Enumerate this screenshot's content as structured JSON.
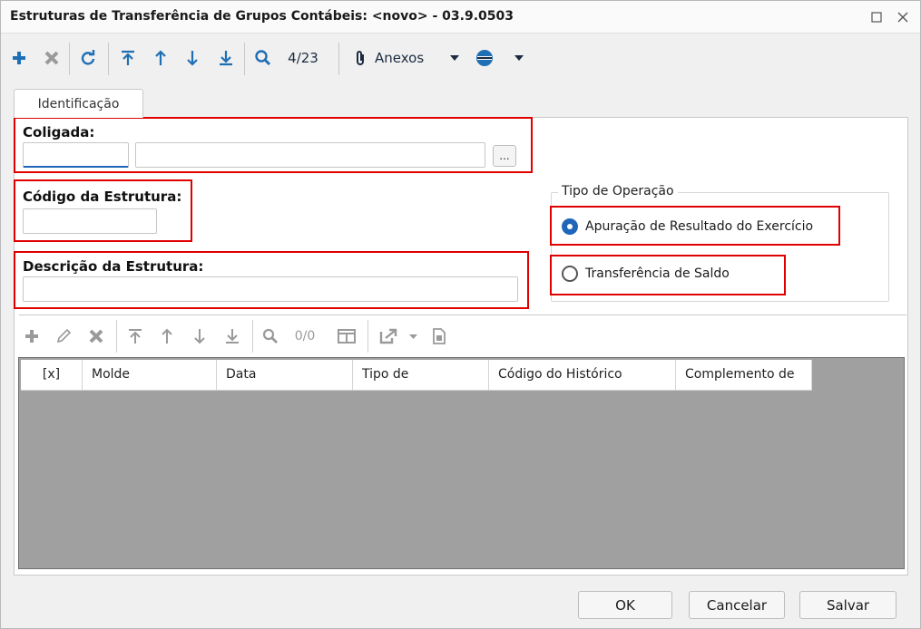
{
  "window": {
    "title": "Estruturas de Transferência de Grupos Contábeis: <novo> - 03.9.0503",
    "maximize_icon": "maximize-icon",
    "close_icon": "close-icon"
  },
  "toolbar": {
    "record_counter": "4/23",
    "attachments_label": "Anexos",
    "icons": [
      "add-icon",
      "delete-icon",
      "refresh-icon",
      "first-record-icon",
      "previous-record-icon",
      "next-record-icon",
      "last-record-icon",
      "search-icon",
      "paperclip-icon",
      "dropdown-arrow-icon",
      "globe-icon",
      "dropdown-arrow-icon"
    ]
  },
  "tabs": [
    {
      "label": "Identificação",
      "active": true
    }
  ],
  "form": {
    "coligada": {
      "label": "Coligada:",
      "code_value": "",
      "name_value": "",
      "browse_label": "..."
    },
    "codigo": {
      "label": "Código da Estrutura:",
      "value": ""
    },
    "descricao": {
      "label": "Descrição da Estrutura:",
      "value": ""
    },
    "tipo_operacao": {
      "legend": "Tipo de Operação",
      "options": [
        {
          "label": "Apuração de Resultado do Exercício",
          "checked": true
        },
        {
          "label": "Transferência de Saldo",
          "checked": false
        }
      ]
    }
  },
  "grid_toolbar": {
    "record_counter": "0/0",
    "icons": [
      "add-icon",
      "edit-icon",
      "delete-icon",
      "first-record-icon",
      "previous-record-icon",
      "next-record-icon",
      "last-record-icon",
      "search-icon",
      "columns-icon",
      "export-icon",
      "dropdown-arrow-icon",
      "document-icon"
    ]
  },
  "grid": {
    "columns": [
      "[x]",
      "Molde",
      "Data",
      "Tipo de",
      "Código do Histórico",
      "Complemento de"
    ],
    "rows": []
  },
  "footer": {
    "ok_label": "OK",
    "cancel_label": "Cancelar",
    "save_label": "Salvar"
  },
  "colors": {
    "accent": "#1f66b8",
    "toolbar_icon": "#1f6fb5",
    "highlight_border": "#e00000",
    "grid_background": "#a0a0a0"
  }
}
